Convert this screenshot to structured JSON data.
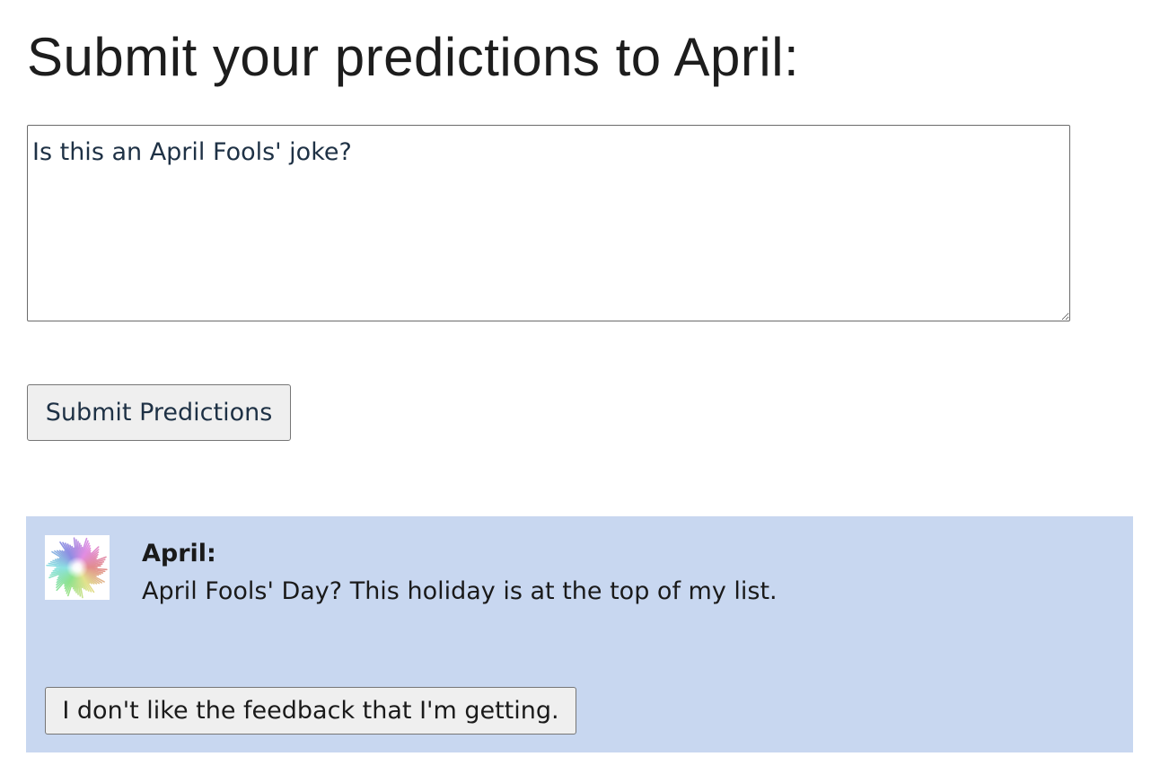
{
  "page": {
    "title": "Submit your predictions to April:"
  },
  "prediction_form": {
    "input_value": "Is this an April Fools' joke?",
    "submit_label": "Submit Predictions"
  },
  "response": {
    "avatar_icon": "starburst-avatar-icon",
    "name": "April:",
    "message": "April Fools' Day? This holiday is at the top of my list.",
    "feedback_button_label": "I don't like the feedback that I'm getting."
  },
  "colors": {
    "panel_background": "#c8d7f0",
    "button_background": "#efefef",
    "input_text": "#1e3145"
  }
}
